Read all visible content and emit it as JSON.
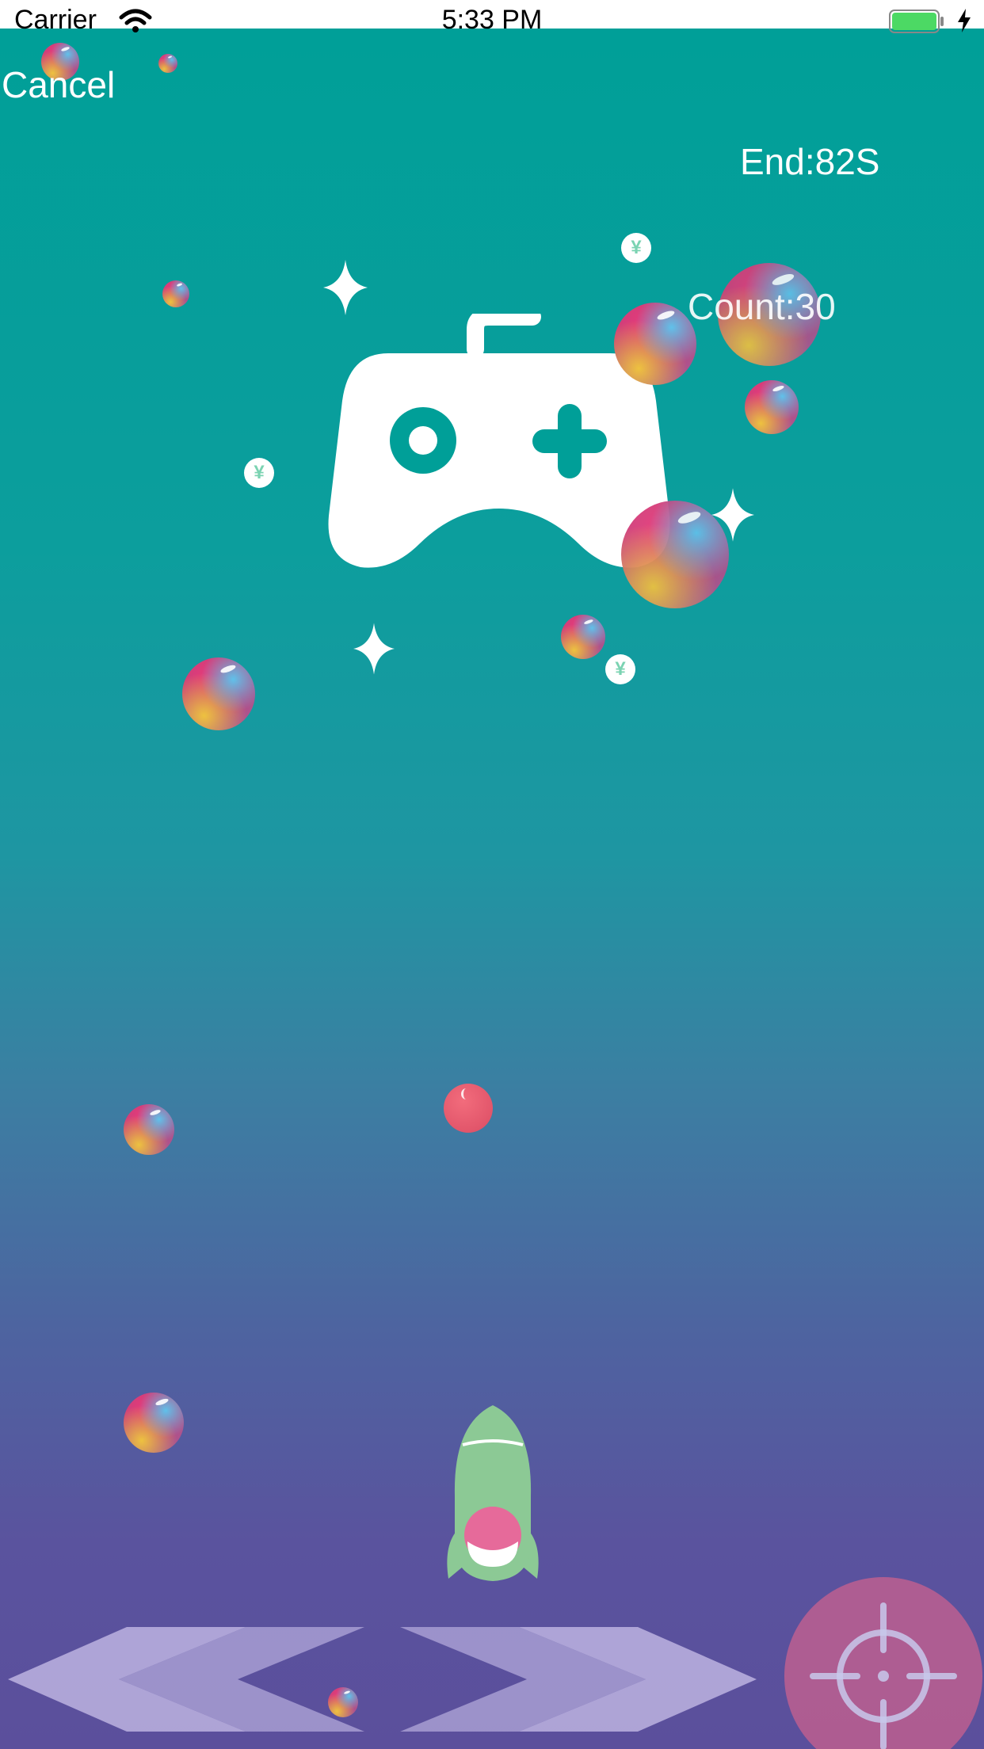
{
  "status_bar": {
    "carrier": "Carrier",
    "time": "5:33 PM",
    "wifi_icon": "wifi-icon",
    "battery_icon": "battery-full-icon",
    "charging_icon": "bolt-icon"
  },
  "game": {
    "cancel_label": "Cancel",
    "end_label": "End:82S",
    "count_label": "Count:30",
    "center_icon": "gamepad-icon",
    "player": "rocket",
    "left_control_icon": "chevrons-left-icon",
    "right_control_icon": "chevrons-right-icon",
    "fire_control_icon": "crosshair-icon",
    "coin_symbol": "¥"
  },
  "colors": {
    "background_top": "#009f98",
    "background_bottom": "#5b4f9c",
    "bullet": "#e2566b",
    "rocket_body": "#8cc995",
    "fire_button": "#dc648c",
    "battery": "#4cd964"
  }
}
